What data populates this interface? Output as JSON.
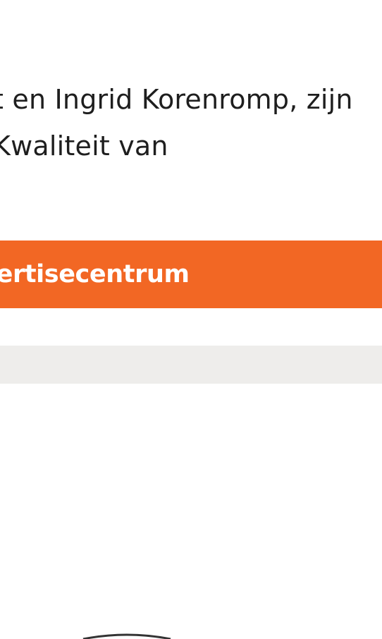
{
  "article": {
    "intro_line_1": "t en Ingrid Korenromp, zijn",
    "intro_line_2": " Kwaliteit van"
  },
  "cta": {
    "label": "pertisecentrum",
    "background_color": "#f26724",
    "text_color": "#ffffff"
  },
  "grey_bar": {
    "color": "#eeedeb"
  },
  "image": {
    "icon": "partial-circle-image"
  }
}
